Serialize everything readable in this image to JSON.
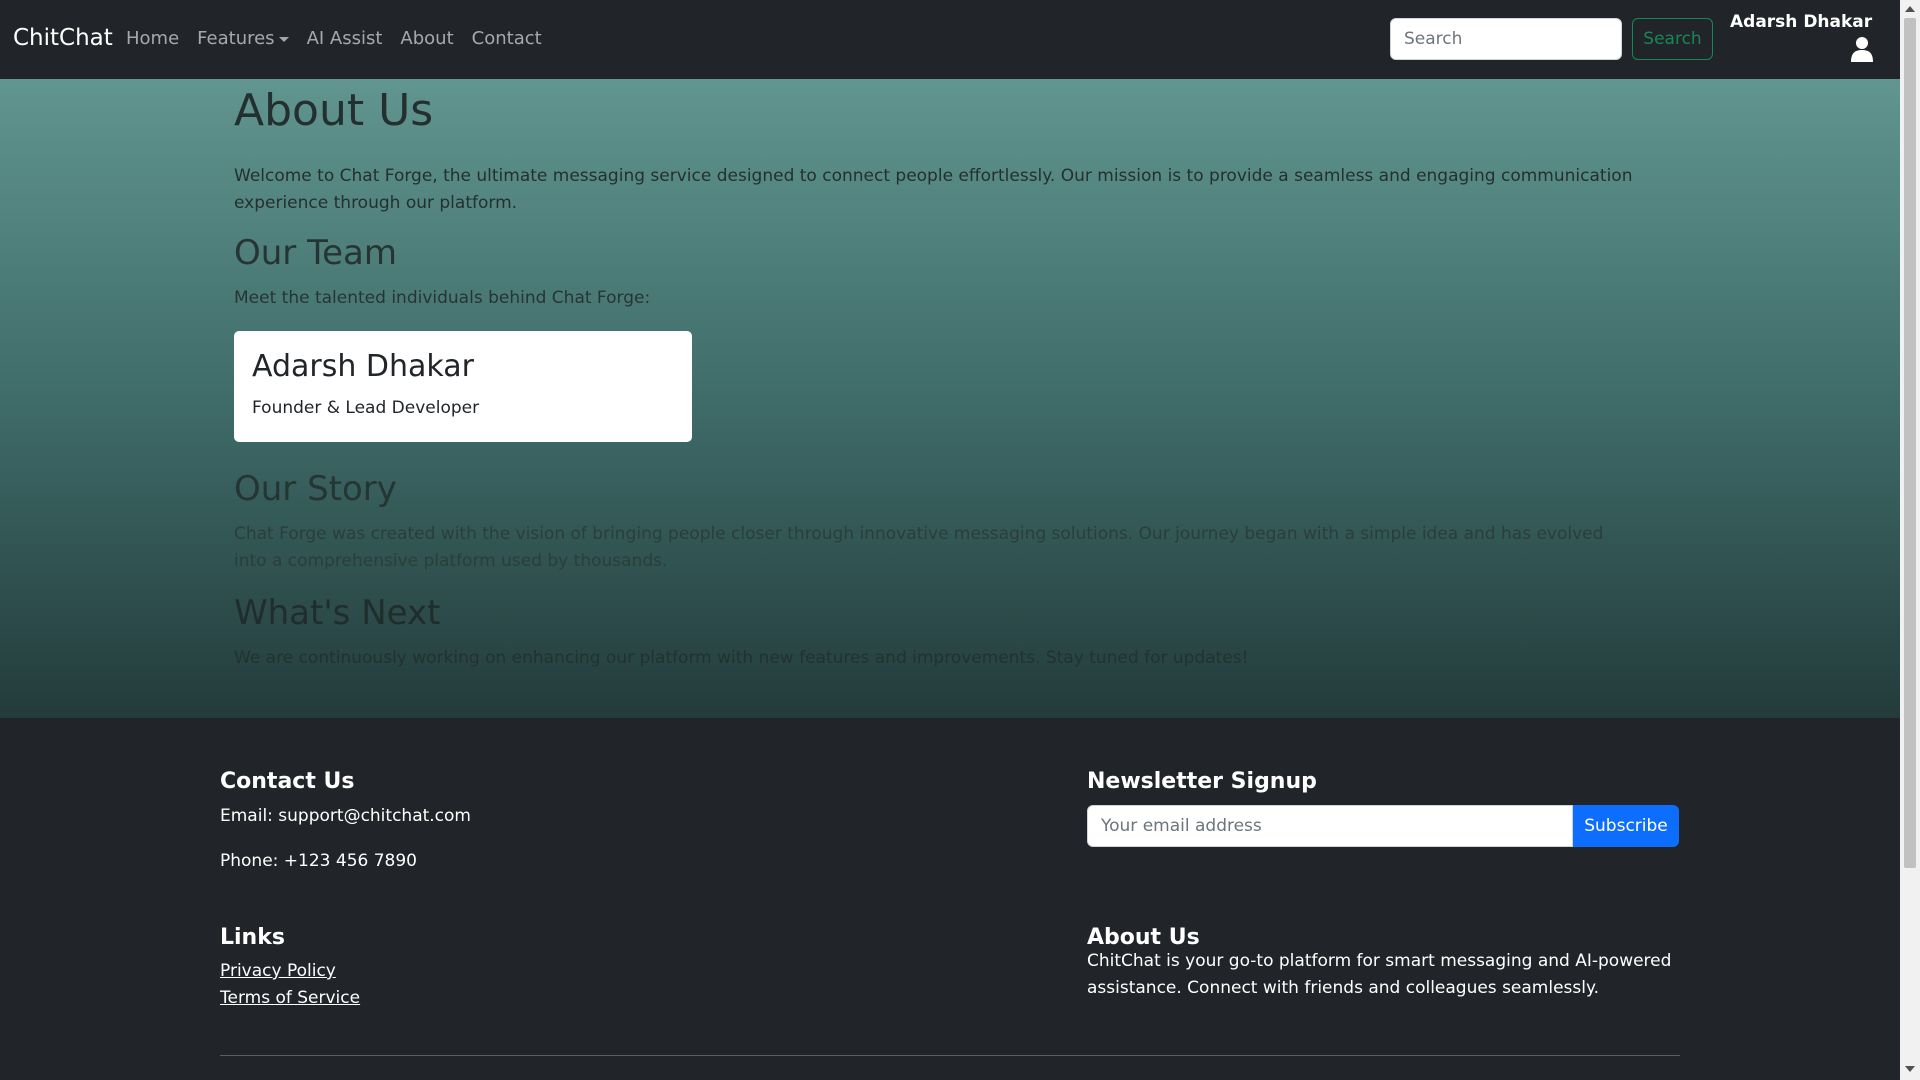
{
  "navbar": {
    "brand": "ChitChat",
    "links": [
      {
        "label": "Home"
      },
      {
        "label": "Features"
      },
      {
        "label": "AI Assist"
      },
      {
        "label": "About"
      },
      {
        "label": "Contact"
      }
    ],
    "search_placeholder": "Search",
    "search_button": "Search",
    "user_name": "Adarsh Dhakar"
  },
  "main": {
    "title": "About Us",
    "intro": "Welcome to Chat Forge, the ultimate messaging service designed to connect people effortlessly. Our mission is to provide a seamless and engaging communication experience through our platform.",
    "team_heading": "Our Team",
    "team_intro": "Meet the talented individuals behind Chat Forge:",
    "team_member": {
      "name": "Adarsh Dhakar",
      "role": "Founder & Lead Developer"
    },
    "story_heading": "Our Story",
    "story_text": "Chat Forge was created with the vision of bringing people closer through innovative messaging solutions. Our journey began with a simple idea and has evolved into a comprehensive platform used by thousands.",
    "next_heading": "What's Next",
    "next_text": "We are continuously working on enhancing our platform with new features and improvements. Stay tuned for updates!"
  },
  "footer": {
    "contact_heading": "Contact Us",
    "email": "Email: support@chitchat.com",
    "phone": "Phone: +123 456 7890",
    "links_heading": "Links",
    "links": [
      {
        "label": "Privacy Policy"
      },
      {
        "label": "Terms of Service"
      }
    ],
    "newsletter_heading": "Newsletter Signup",
    "newsletter_placeholder": "Your email address",
    "subscribe_button": "Subscribe",
    "about_heading": "About Us",
    "about_text": "ChitChat is your go-to platform for smart messaging and AI-powered assistance. Connect with friends and colleagues seamlessly."
  },
  "colors": {
    "navbar_bg": "#212529",
    "footer_bg": "#212529",
    "gradient_top": "#61958f",
    "gradient_bottom": "#233b3b",
    "search_button": "#198754",
    "subscribe_button": "#0d6efd"
  }
}
